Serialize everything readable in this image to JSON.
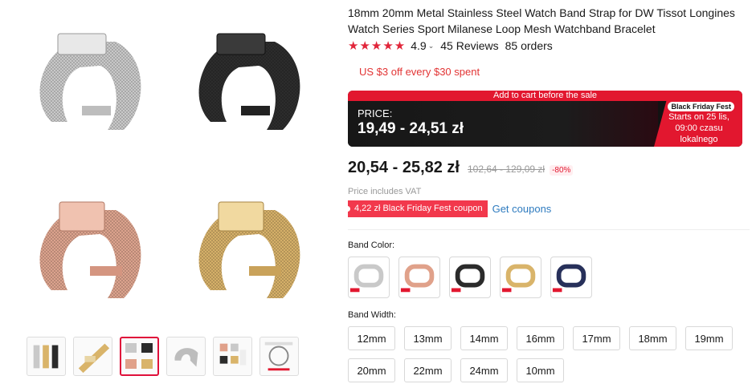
{
  "product": {
    "title": "18mm 20mm Metal Stainless Steel Watch Band Strap for DW Tissot Longines Watch Series Sport Milanese Loop Mesh Watchband Bracelet",
    "rating_stars": "★★★★★",
    "rating_value": "4.9",
    "reviews": "45 Reviews",
    "orders": "85 orders",
    "store_coupon": "US $3 off every $30 spent"
  },
  "sale_banner": {
    "strip": "Add to cart before the sale",
    "price_label": "PRICE:",
    "price": "19,49 - 24,51 zł",
    "badge": "Black Friday Fest",
    "starts": "Starts on 25 lis, 09:00 czasu lokalnego"
  },
  "pricing": {
    "current": "20,54 - 25,82 zł",
    "original": "102,64 - 129,09 zł",
    "discount": "-80%",
    "vat_note": "Price includes VAT",
    "coupon": "4,22 zł Black Friday Fest coupon",
    "get_coupons": "Get coupons"
  },
  "band_color": {
    "label": "Band Color:",
    "options": [
      "silver",
      "rose-gold",
      "black",
      "gold",
      "blue"
    ]
  },
  "band_width": {
    "label": "Band Width:",
    "options": [
      "12mm",
      "13mm",
      "14mm",
      "16mm",
      "17mm",
      "18mm",
      "19mm",
      "20mm",
      "22mm",
      "24mm",
      "10mm"
    ]
  },
  "colors": {
    "accent": "#e2172f",
    "silver": "#c9c9c9",
    "black": "#2b2b2b",
    "rose": "#e0a18a",
    "gold": "#d9b46a",
    "blue": "#27305a",
    "link": "#2e7bbf"
  }
}
